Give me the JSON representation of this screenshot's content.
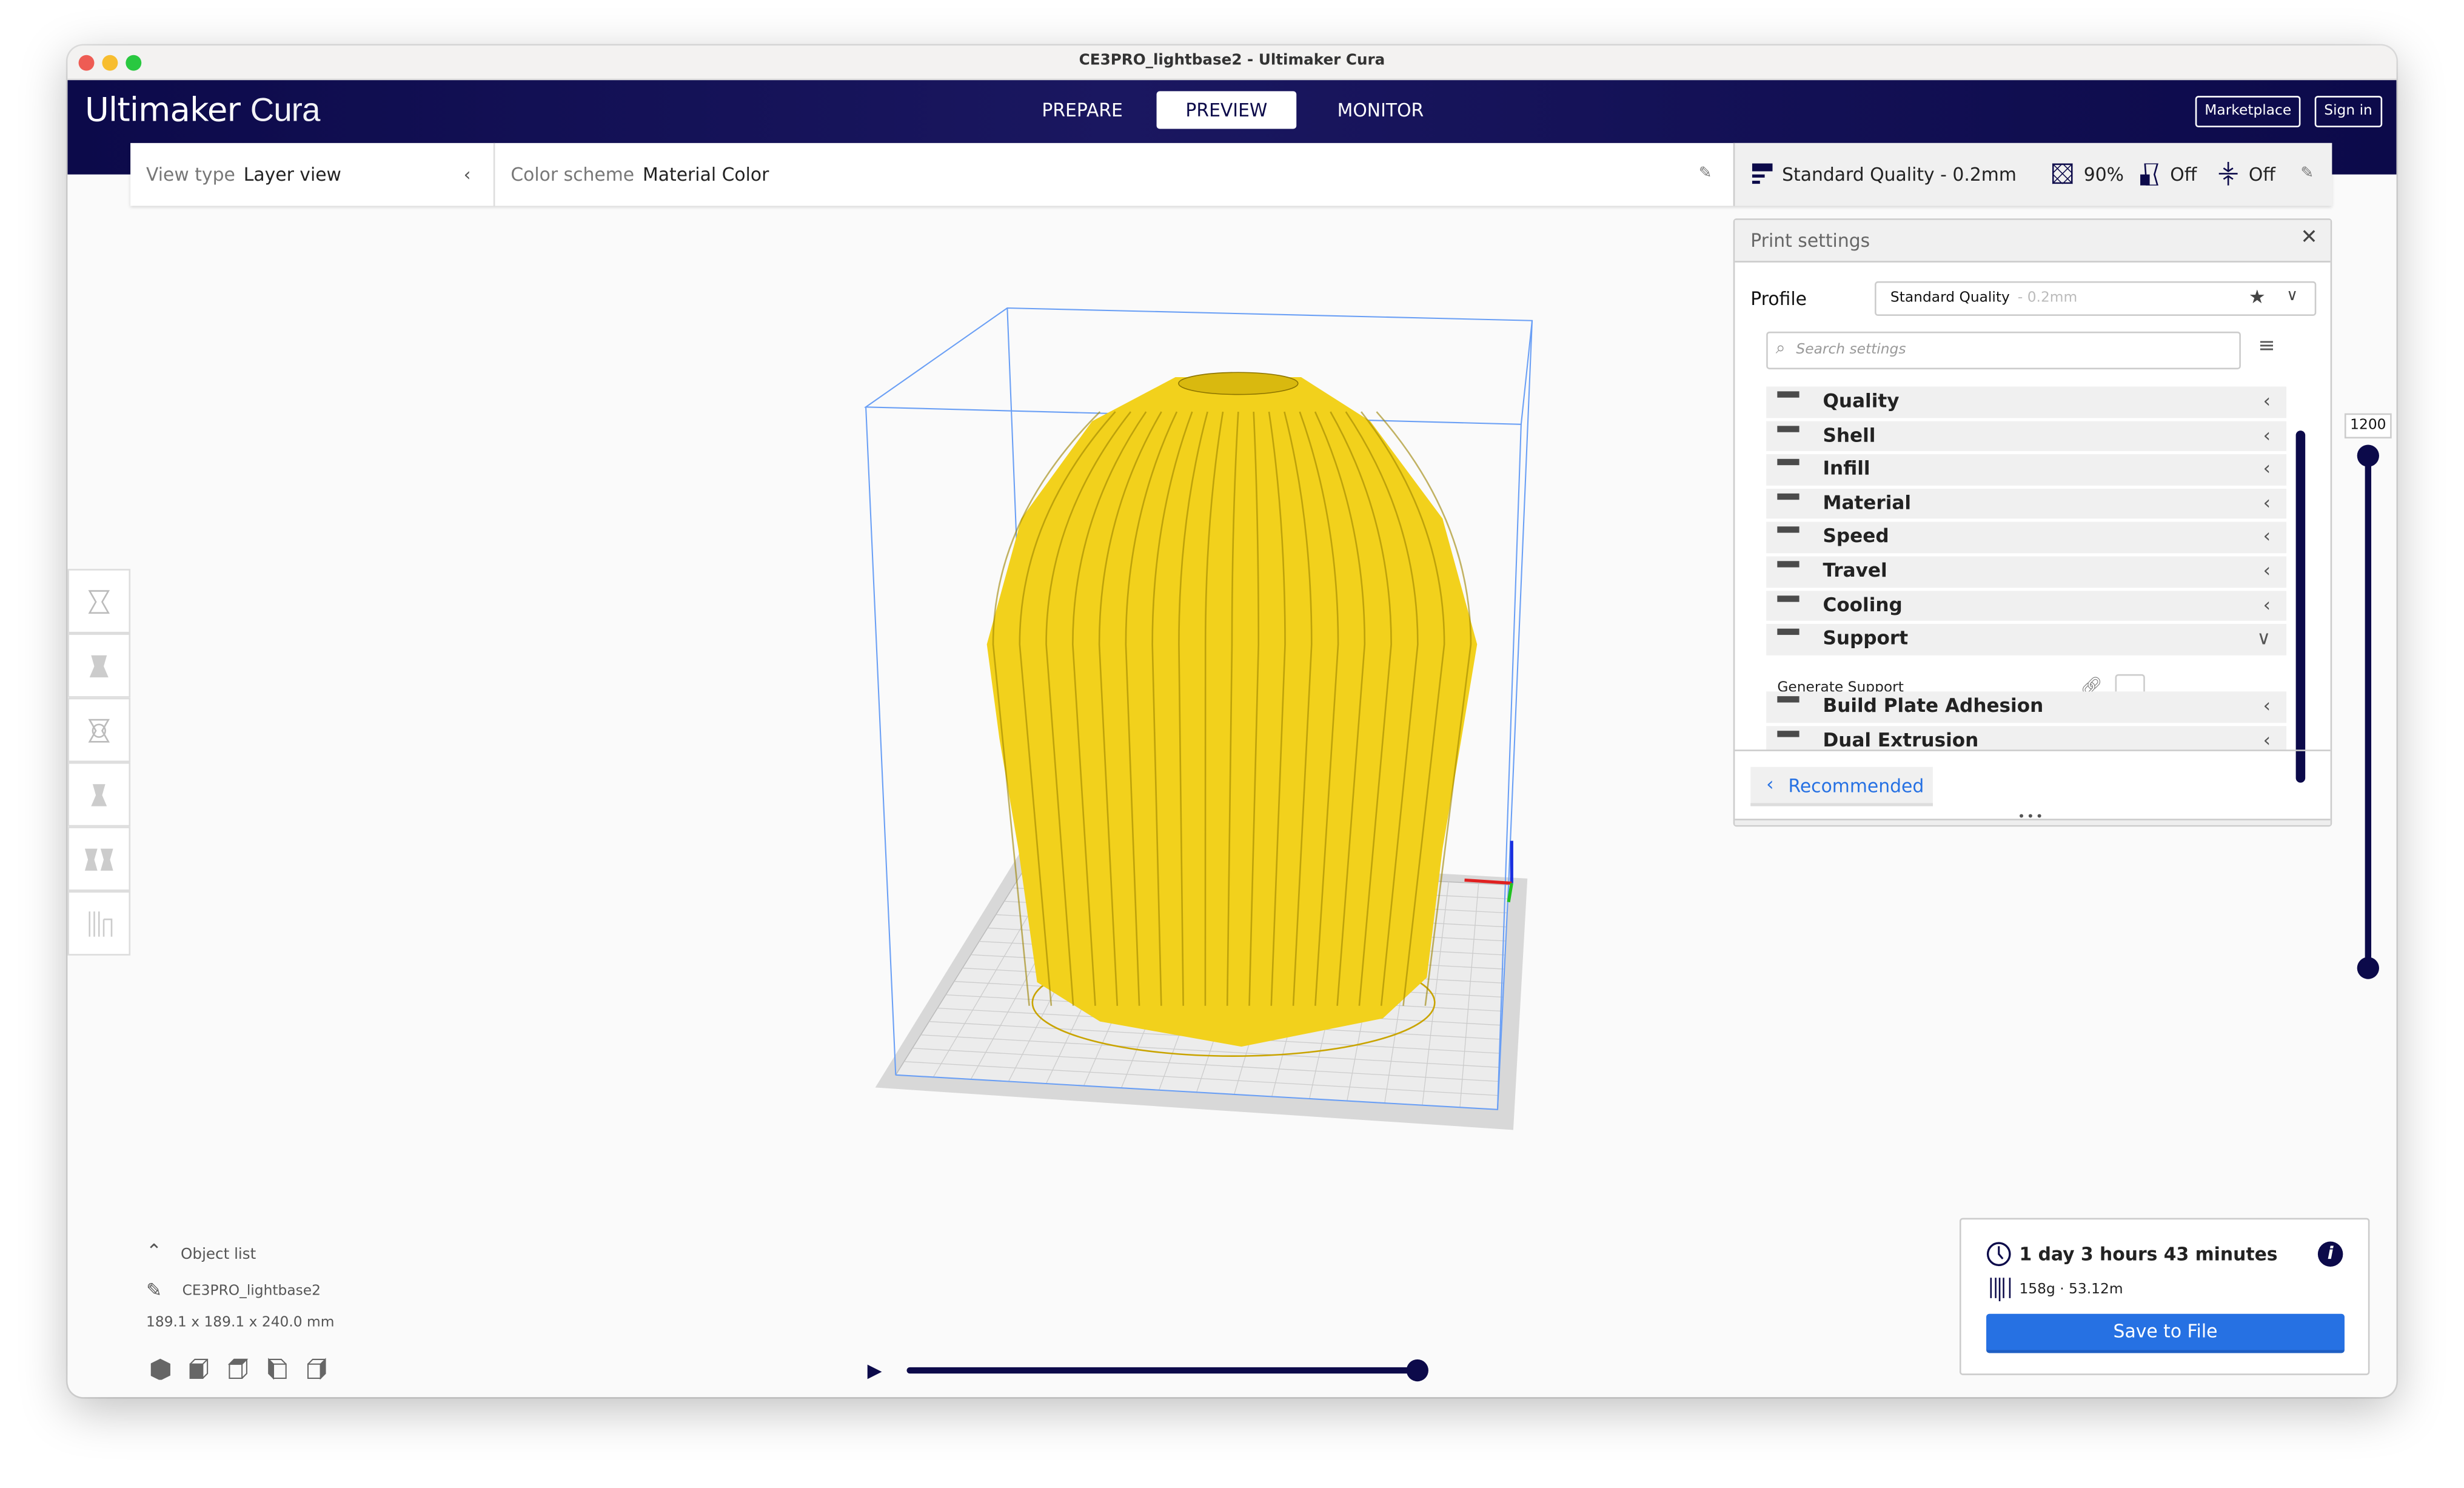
{
  "window": {
    "title": "CE3PRO_lightbase2 - Ultimaker Cura"
  },
  "header": {
    "logo_main": "Ultimaker",
    "logo_sub": "Cura",
    "tabs": [
      {
        "label": "PREPARE"
      },
      {
        "label": "PREVIEW",
        "active": true
      },
      {
        "label": "MONITOR"
      }
    ],
    "marketplace_label": "Marketplace",
    "signin_label": "Sign in",
    "color": "#0c0a4a"
  },
  "toolbar": {
    "view_type_label": "View type",
    "view_type_value": "Layer view",
    "color_scheme_label": "Color scheme",
    "color_scheme_value": "Material Color",
    "profile_summary": "Standard Quality - 0.2mm",
    "infill": "90%",
    "support": "Off",
    "adhesion": "Off"
  },
  "print_settings": {
    "title": "Print settings",
    "profile_label": "Profile",
    "profile_name": "Standard Quality",
    "profile_suffix": "- 0.2mm",
    "search_placeholder": "Search settings",
    "categories": [
      {
        "label": "Quality",
        "icon": "quality-icon"
      },
      {
        "label": "Shell",
        "icon": "shell-icon"
      },
      {
        "label": "Infill",
        "icon": "infill-icon"
      },
      {
        "label": "Material",
        "icon": "material-icon"
      },
      {
        "label": "Speed",
        "icon": "speed-icon"
      },
      {
        "label": "Travel",
        "icon": "travel-icon"
      },
      {
        "label": "Cooling",
        "icon": "cooling-icon"
      },
      {
        "label": "Support",
        "icon": "support-icon",
        "expanded": true
      },
      {
        "label": "Build Plate Adhesion",
        "icon": "adhesion-icon"
      },
      {
        "label": "Dual Extrusion",
        "icon": "dual-extrusion-icon"
      }
    ],
    "generate_support_label": "Generate Support",
    "generate_support_checked": false,
    "recommended_label": "Recommended"
  },
  "layer_slider": {
    "top_value": "1200"
  },
  "object_list": {
    "label": "Object list",
    "object_name": "CE3PRO_lightbase2",
    "dimensions": "189.1 x 189.1 x 240.0 mm"
  },
  "playback": {
    "progress": 1.0
  },
  "print_info": {
    "time": "1 day 3 hours 43 minutes",
    "material": "158g · 53.12m",
    "save_label": "Save to File",
    "accent": "#2671e3"
  },
  "model": {
    "color": "#f2d11c"
  }
}
